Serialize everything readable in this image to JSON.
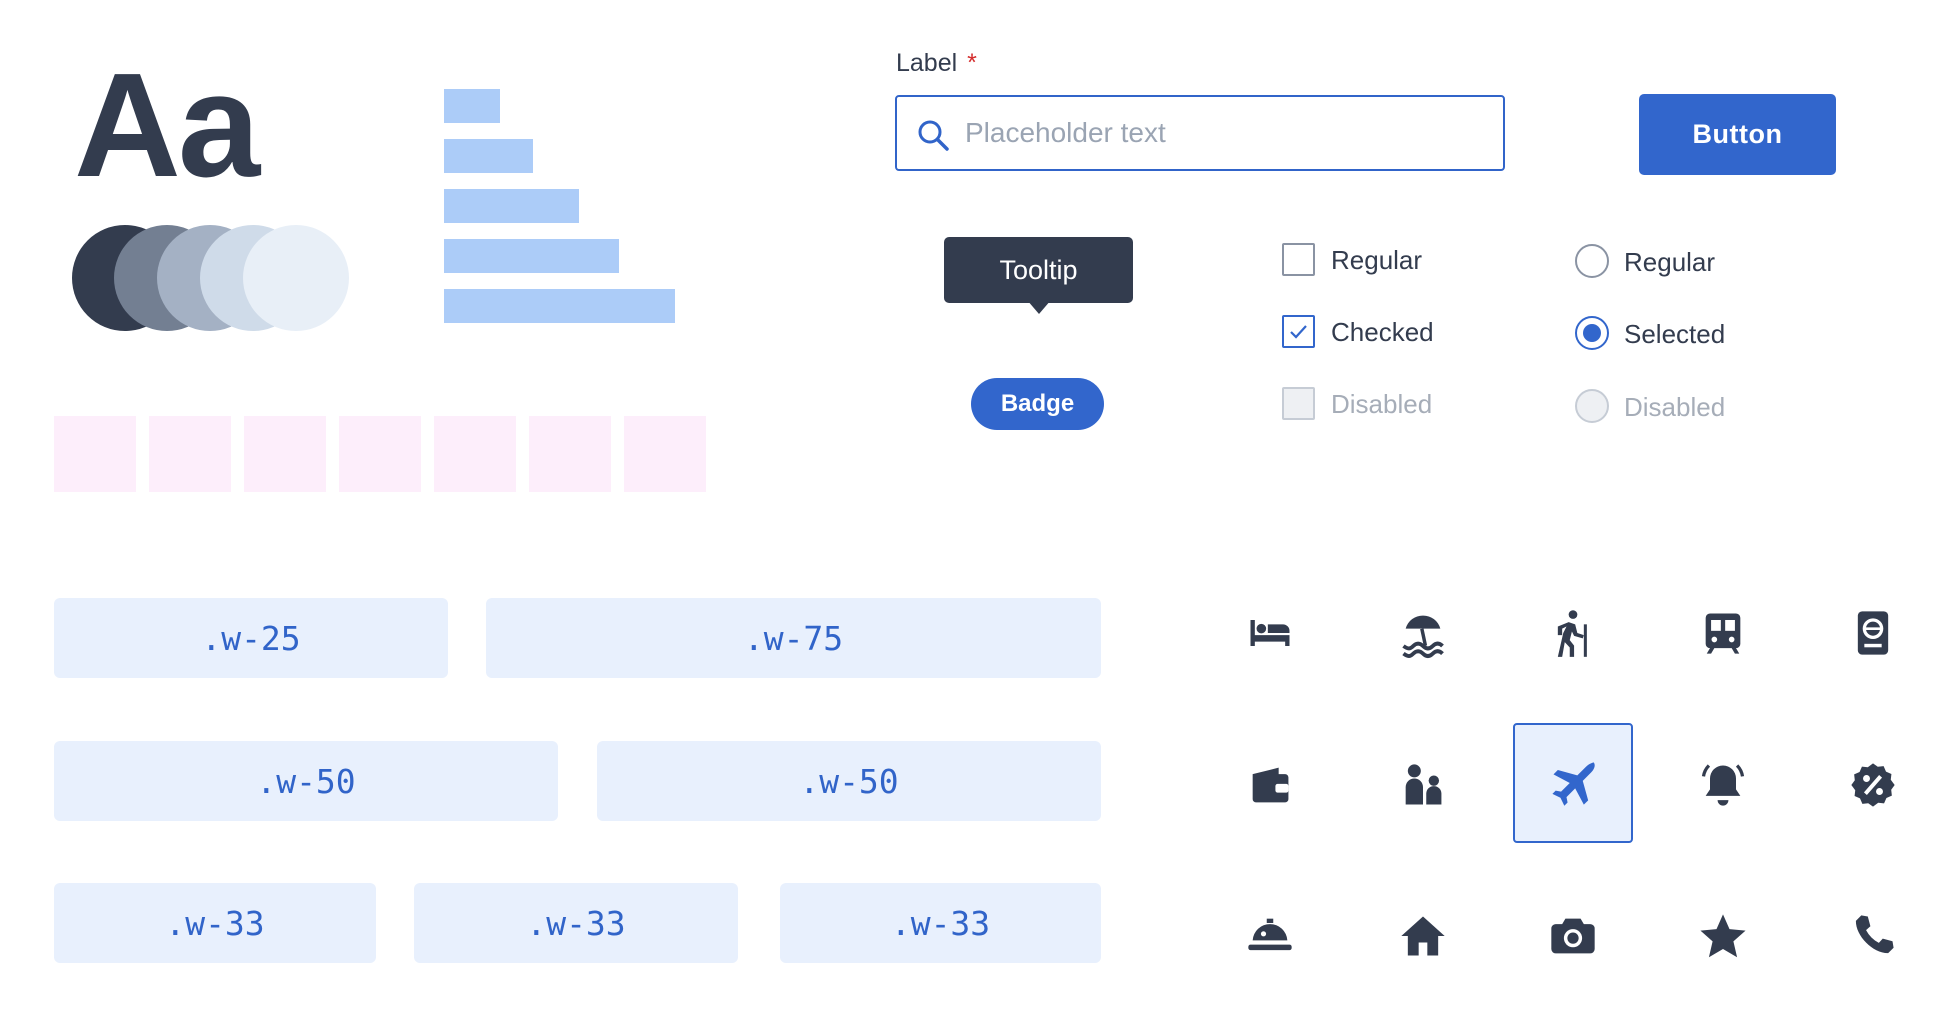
{
  "typography": {
    "sample": "Aa"
  },
  "palette": {
    "circles": [
      "#333c4e",
      "#737f92",
      "#a4b1c4",
      "#cfdbe9",
      "#e8eff7"
    ],
    "bars": "#acccf8",
    "squares": "#fdeefb"
  },
  "form": {
    "label": "Label",
    "required_mark": "*",
    "search": {
      "placeholder": "Placeholder text",
      "value": ""
    },
    "button_label": "Button"
  },
  "tooltip": {
    "text": "Tooltip"
  },
  "badge": {
    "text": "Badge"
  },
  "checkboxes": [
    {
      "label": "Regular",
      "state": "unchecked"
    },
    {
      "label": "Checked",
      "state": "checked"
    },
    {
      "label": "Disabled",
      "state": "disabled"
    }
  ],
  "radios": [
    {
      "label": "Regular",
      "state": "unselected"
    },
    {
      "label": "Selected",
      "state": "selected"
    },
    {
      "label": "Disabled",
      "state": "disabled"
    }
  ],
  "width_utilities": [
    [
      ".w-25",
      ".w-75"
    ],
    [
      ".w-50",
      ".w-50"
    ],
    [
      ".w-33",
      ".w-33",
      ".w-33"
    ]
  ],
  "icons": [
    [
      "bed-icon",
      "beach-umbrella-icon",
      "hiking-icon",
      "train-icon",
      "passport-icon"
    ],
    [
      "wallet-icon",
      "family-icon",
      "airplane-icon",
      "notification-bell-icon",
      "discount-icon"
    ],
    [
      "room-service-icon",
      "home-icon",
      "camera-icon",
      "star-icon",
      "phone-icon"
    ]
  ],
  "selected_icon": "airplane-icon",
  "colors": {
    "accent": "#3266cc",
    "ink": "#333c4e",
    "tint": "#e8f0fd"
  }
}
